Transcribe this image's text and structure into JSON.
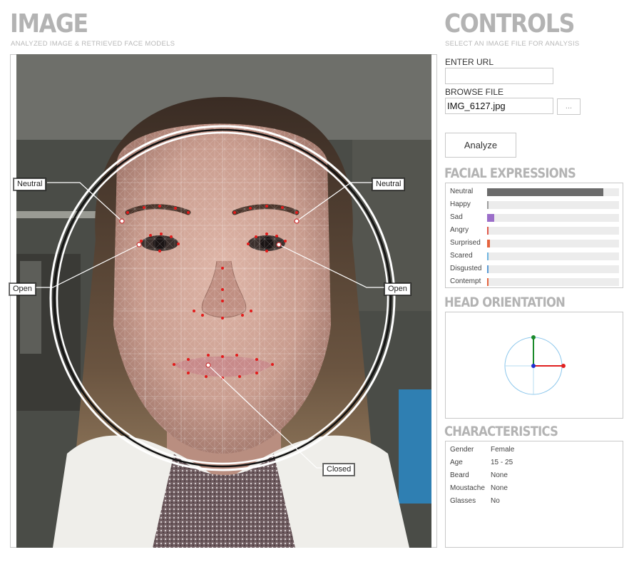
{
  "image_section": {
    "title": "IMAGE",
    "subtitle": "ANALYZED IMAGE & RETRIEVED FACE MODELS",
    "callouts": {
      "left_brow": "Neutral",
      "right_brow": "Neutral",
      "left_eye": "Open",
      "right_eye": "Open",
      "mouth": "Closed"
    }
  },
  "controls": {
    "title": "CONTROLS",
    "subtitle": "SELECT AN IMAGE FILE FOR ANALYSIS",
    "enter_url_label": "ENTER URL",
    "url_value": "",
    "browse_file_label": "BROWSE FILE",
    "file_value": "IMG_6127.jpg",
    "browse_button": "...",
    "analyze_button": "Analyze"
  },
  "facial_expressions": {
    "title": "FACIAL EXPRESSIONS",
    "items": [
      {
        "label": "Neutral",
        "value": 0.88,
        "color": "#6b6b6b"
      },
      {
        "label": "Happy",
        "value": 0.004,
        "color": "#9e9e9e"
      },
      {
        "label": "Sad",
        "value": 0.055,
        "color": "#9b6ec9"
      },
      {
        "label": "Angry",
        "value": 0.008,
        "color": "#e0584a"
      },
      {
        "label": "Surprised",
        "value": 0.02,
        "color": "#e5643e"
      },
      {
        "label": "Scared",
        "value": 0.008,
        "color": "#6fb6e0"
      },
      {
        "label": "Disgusted",
        "value": 0.008,
        "color": "#5b9bd5"
      },
      {
        "label": "Contempt",
        "value": 0.008,
        "color": "#e5643e"
      }
    ]
  },
  "head_orientation": {
    "title": "HEAD ORIENTATION",
    "axis_colors": {
      "up": "#1a8a2a",
      "right": "#e02020",
      "center": "#2030d0",
      "circle": "#8cc7ec"
    }
  },
  "characteristics": {
    "title": "CHARACTERISTICS",
    "rows": [
      {
        "key": "Gender",
        "value": "Female"
      },
      {
        "key": "Age",
        "value": "15 - 25"
      },
      {
        "key": "Beard",
        "value": "None"
      },
      {
        "key": "Moustache",
        "value": "None"
      },
      {
        "key": "Glasses",
        "value": "No"
      }
    ]
  }
}
